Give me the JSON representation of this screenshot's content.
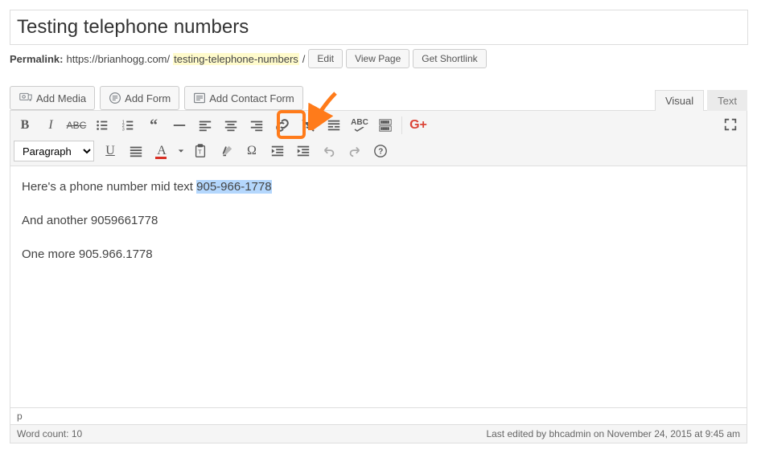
{
  "title": "Testing telephone numbers",
  "permalink": {
    "label": "Permalink:",
    "base": "https://brianhogg.com/",
    "slug": "testing-telephone-numbers",
    "trail": "/",
    "edit": "Edit",
    "view": "View Page",
    "shortlink": "Get Shortlink"
  },
  "media_buttons": {
    "add_media": "Add Media",
    "add_form": "Add Form",
    "add_contact_form": "Add Contact Form"
  },
  "tabs": {
    "visual": "Visual",
    "text": "Text"
  },
  "format_select": "Paragraph",
  "content": {
    "p1_pre": "Here's a phone number mid text ",
    "p1_sel": "905-966-1778",
    "p2": "And another 9059661778",
    "p3": "One more 905.966.1778"
  },
  "path": "p",
  "footer": {
    "wordcount_label": "Word count: ",
    "wordcount": "10",
    "lastedit": "Last edited by bhcadmin on November 24, 2015 at 9:45 am"
  }
}
